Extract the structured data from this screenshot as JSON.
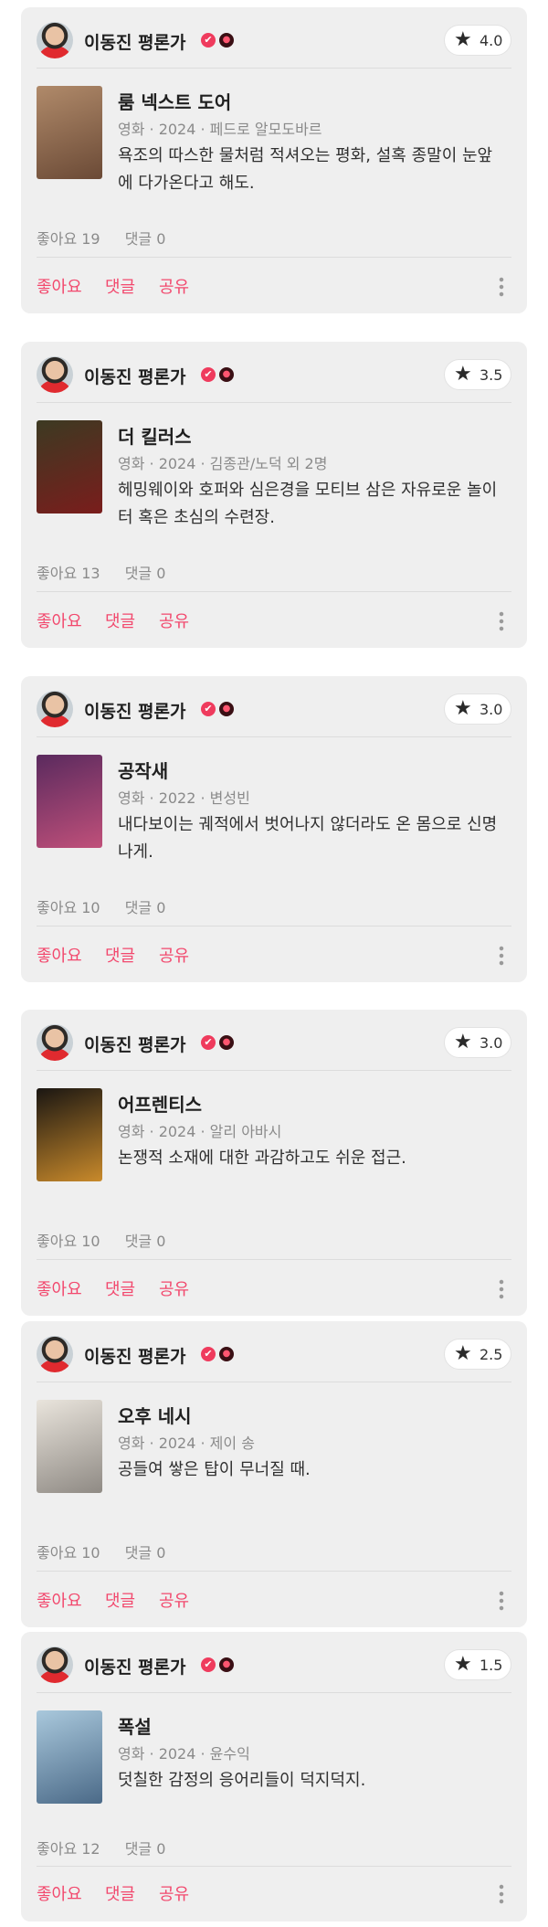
{
  "common": {
    "author": "이동진 평론가",
    "badge_check": "✔",
    "badge_emblem": "●",
    "star_icon": "★",
    "like_label": "좋아요",
    "comment_label": "댓글",
    "share_label": "공유",
    "accent_color": "#f2486d"
  },
  "reviews": [
    {
      "rating": "4.0",
      "title": "룸 넥스트 도어",
      "meta": "영화 · 2024 · 페드로 알모도바르",
      "comment": "욕조의 따스한 물처럼 적셔오는 평화, 설혹 종말이 눈앞에 다가온다고 해도.",
      "likes": "좋아요 19",
      "comments": "댓글 0",
      "poster_colors": [
        "#b08a6a",
        "#6b4a36"
      ]
    },
    {
      "rating": "3.5",
      "title": "더 킬러스",
      "meta": "영화 · 2024 · 김종관/노덕 외 2명",
      "comment": "헤밍웨이와 호퍼와 심은경을 모티브 삼은 자유로운 놀이터 혹은 초심의 수련장.",
      "likes": "좋아요 13",
      "comments": "댓글 0",
      "poster_colors": [
        "#3c3a22",
        "#7a1d1c"
      ]
    },
    {
      "rating": "3.0",
      "title": "공작새",
      "meta": "영화 · 2022 · 변성빈",
      "comment": "내다보이는 궤적에서 벗어나지 않더라도 온 몸으로 신명나게.",
      "likes": "좋아요 10",
      "comments": "댓글 0",
      "poster_colors": [
        "#5a2a5e",
        "#c0507a"
      ]
    },
    {
      "rating": "3.0",
      "title": "어프렌티스",
      "meta": "영화 · 2024 · 알리 아바시",
      "comment": "논쟁적 소재에 대한 과감하고도 쉬운 접근.",
      "likes": "좋아요 10",
      "comments": "댓글 0",
      "poster_colors": [
        "#1a1612",
        "#c98a2b"
      ]
    },
    {
      "rating": "2.5",
      "title": "오후 네시",
      "meta": "영화 · 2024 · 제이 송",
      "comment": "공들여 쌓은 탑이 무너질 때.",
      "likes": "좋아요 10",
      "comments": "댓글 0",
      "poster_colors": [
        "#e9e4dc",
        "#8f8a84"
      ]
    },
    {
      "rating": "1.5",
      "title": "폭설",
      "meta": "영화 · 2024 · 윤수익",
      "comment": "덧칠한 감정의 응어리들이 덕지덕지.",
      "likes": "좋아요 12",
      "comments": "댓글 0",
      "poster_colors": [
        "#a9c8dc",
        "#4b6a88"
      ]
    }
  ]
}
